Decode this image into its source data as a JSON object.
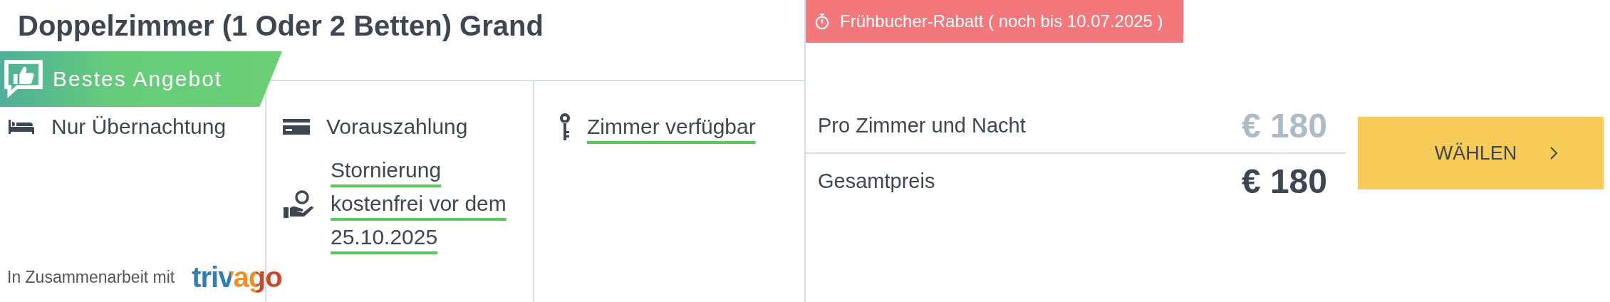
{
  "room": {
    "title": "Doppelzimmer (1 Oder 2 Betten) Grand"
  },
  "badge": {
    "label": "Bestes Angebot"
  },
  "columns": [
    {
      "items": [
        {
          "text": "Nur Übernachtung",
          "underlined": false
        }
      ]
    },
    {
      "items": [
        {
          "text": "Vorauszahlung",
          "underlined": false
        },
        {
          "text": "Stornierung kostenfrei vor dem 25.10.2025",
          "underlined": true
        }
      ]
    },
    {
      "items": [
        {
          "text": "Zimmer verfügbar",
          "underlined": true
        }
      ]
    }
  ],
  "partner": {
    "text": "In Zusammenarbeit mit",
    "logo": "trivago"
  },
  "promo": {
    "label": "Frühbucher-Rabatt ( noch bis 10.07.2025 )"
  },
  "prices": [
    {
      "label": "Pro Zimmer und Nacht",
      "amount": "€ 180",
      "emphasis": false
    },
    {
      "label": "Gesamtpreis",
      "amount": "€ 180",
      "emphasis": true
    }
  ],
  "button": {
    "label": "WÄHLEN"
  }
}
